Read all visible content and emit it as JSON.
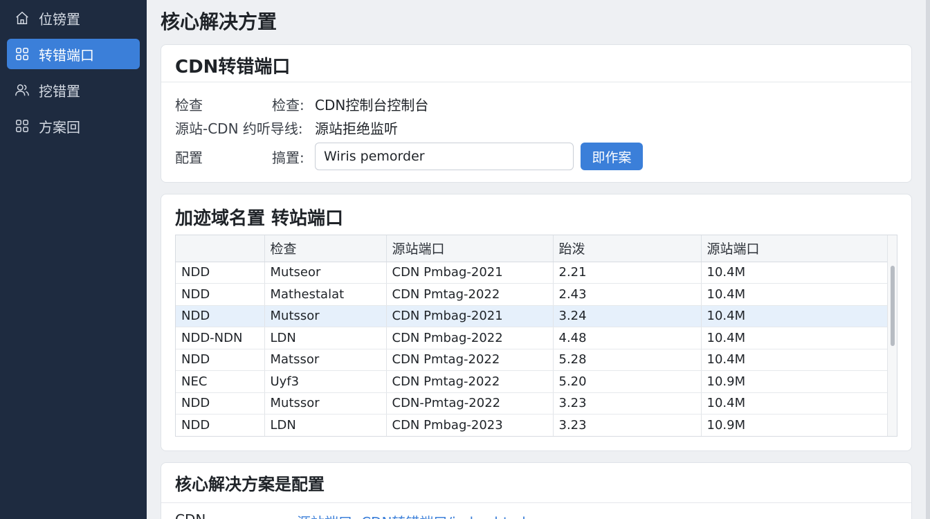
{
  "sidebar": {
    "items": [
      {
        "label": "位镑置",
        "icon": "home-icon",
        "active": false
      },
      {
        "label": "转错端口",
        "icon": "grid-icon",
        "active": true
      },
      {
        "label": "挖错置",
        "icon": "users-icon",
        "active": false
      },
      {
        "label": "方案回",
        "icon": "grid-icon",
        "active": false
      }
    ]
  },
  "page": {
    "title": "核心解决方置"
  },
  "card1": {
    "title": "CDN转错端口",
    "rows": [
      {
        "label": "检查",
        "sub": "检查:",
        "value": "CDN控制台控制台"
      },
      {
        "label": "源站-CDN 约听导线:",
        "value": "源站拒绝监听"
      }
    ],
    "config": {
      "label": "配置",
      "sub": "搞置:",
      "input_value": "Wiris pemorder",
      "button": "即作案"
    }
  },
  "card2": {
    "title": "加迹域名置   转站端口",
    "columns": [
      "",
      "检查",
      "源站端口",
      "跆泼",
      "源站端口"
    ],
    "rows": [
      [
        "NDD",
        "Mutseor",
        "CDN Pmbag-2021",
        "2.21",
        "10.4M"
      ],
      [
        "NDD",
        "Mathestalat",
        "CDN Pmtag-2022",
        "2.43",
        "10.4M"
      ],
      [
        "NDD",
        "Mutssor",
        "CDN Pmbag-2021",
        "3.24",
        "10.4M"
      ],
      [
        "NDD-NDN",
        "LDN",
        "CDN Pmbag-2022",
        "4.48",
        "10.4M"
      ],
      [
        "NDD",
        "Matssor",
        "CDN Pmtag-2022",
        "5.28",
        "10.4M"
      ],
      [
        "NEC",
        "Uyf3",
        "CDN Pmtag-2022",
        "5.20",
        "10.9M"
      ],
      [
        "NDD",
        "Mutssor",
        "CDN-Pmtag-2022",
        "3.23",
        "10.4M"
      ],
      [
        "NDD",
        "LDN",
        "CDN Pmbag-2023",
        "3.23",
        "10.9M"
      ]
    ],
    "selected_row": 2
  },
  "card3": {
    "title": "核心解决方案是配置",
    "row": {
      "label": "CDN",
      "link": "源站端口: CDN转错端口/index.html"
    }
  }
}
